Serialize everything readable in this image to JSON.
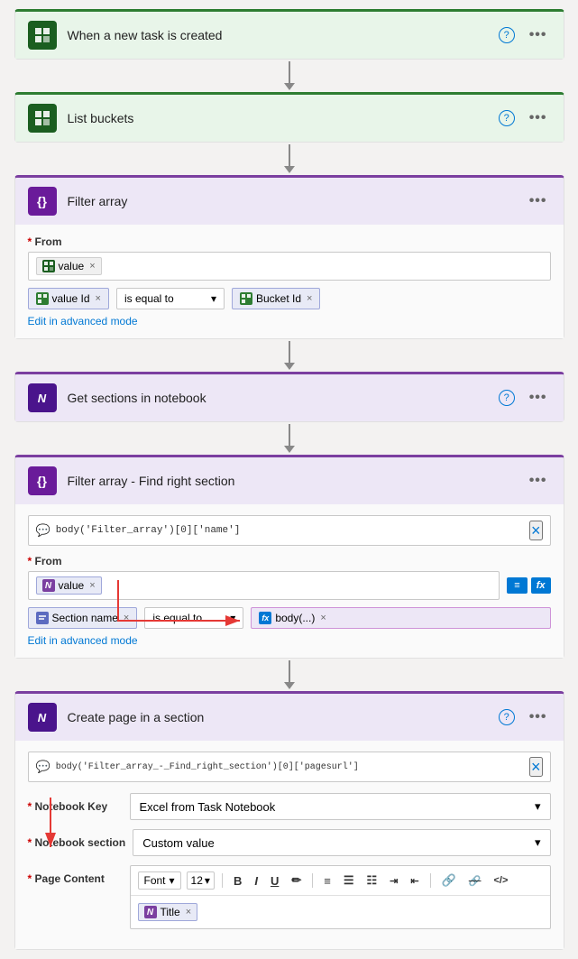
{
  "cards": [
    {
      "id": "trigger",
      "title": "When a new task is created",
      "iconType": "planner",
      "headerBg": "green-bg",
      "borderColor": "green",
      "hasBody": false,
      "hasHelp": true,
      "hasMore": true
    },
    {
      "id": "list-buckets",
      "title": "List buckets",
      "iconType": "planner",
      "headerBg": "green-bg",
      "borderColor": "green",
      "hasBody": false,
      "hasHelp": true,
      "hasMore": true
    },
    {
      "id": "filter-array",
      "title": "Filter array",
      "iconType": "filter",
      "headerBg": "purple-bg",
      "borderColor": "purple",
      "hasBody": true,
      "hasHelp": false,
      "hasMore": true,
      "body": {
        "fromLabel": "From",
        "fromTag": {
          "label": "value",
          "iconType": "planner"
        },
        "filterRow": {
          "left": {
            "label": "value Id",
            "iconType": "planner"
          },
          "op": "is equal to",
          "right": {
            "label": "Bucket Id",
            "iconType": "planner"
          }
        },
        "advancedLink": "Edit in advanced mode"
      }
    },
    {
      "id": "get-sections",
      "title": "Get sections in notebook",
      "iconType": "onenote",
      "headerBg": "purple-bg",
      "borderColor": "purple",
      "hasBody": false,
      "hasHelp": true,
      "hasMore": true
    },
    {
      "id": "filter-array-2",
      "title": "Filter array - Find right section",
      "iconType": "filter",
      "headerBg": "purple-bg",
      "borderColor": "purple",
      "hasBody": true,
      "hasHelp": false,
      "hasMore": true,
      "body": {
        "formulaBar": "body('Filter_array')[0]['name']",
        "fromLabel": "From",
        "fromTag": {
          "label": "value",
          "iconType": "onenote"
        },
        "filterRow": {
          "left": {
            "label": "Section name",
            "iconType": "filter"
          },
          "op": "is equal to",
          "right": {
            "label": "body(...)",
            "iconType": "fx"
          }
        },
        "advancedLink": "Edit in advanced mode",
        "hasActionBtns": true
      }
    },
    {
      "id": "create-page",
      "title": "Create page in a section",
      "iconType": "onenote",
      "headerBg": "purple-bg",
      "borderColor": "purple",
      "hasBody": true,
      "hasHelp": true,
      "hasMore": true,
      "body": {
        "formulaBar": "body('Filter_array_-_Find_right_section')[0]['pagesurl']",
        "fields": [
          {
            "label": "Notebook Key",
            "required": true,
            "type": "dropdown",
            "value": "Excel from Task Notebook"
          },
          {
            "label": "Notebook section",
            "required": true,
            "type": "dropdown",
            "value": "Custom value"
          },
          {
            "label": "Page Content",
            "required": true,
            "type": "toolbar"
          }
        ],
        "toolbar": {
          "font": "Font",
          "fontSize": "12",
          "buttons": [
            "B",
            "I",
            "U",
            "✏",
            "≡",
            "☰",
            "☷",
            "←→",
            "🔗",
            "⛓",
            "</>"
          ]
        },
        "titleTag": {
          "label": "Title",
          "iconType": "onenote"
        }
      }
    }
  ],
  "icons": {
    "help": "?",
    "more": "•••",
    "close": "×",
    "chevron_down": "▾",
    "fx": "fx"
  }
}
